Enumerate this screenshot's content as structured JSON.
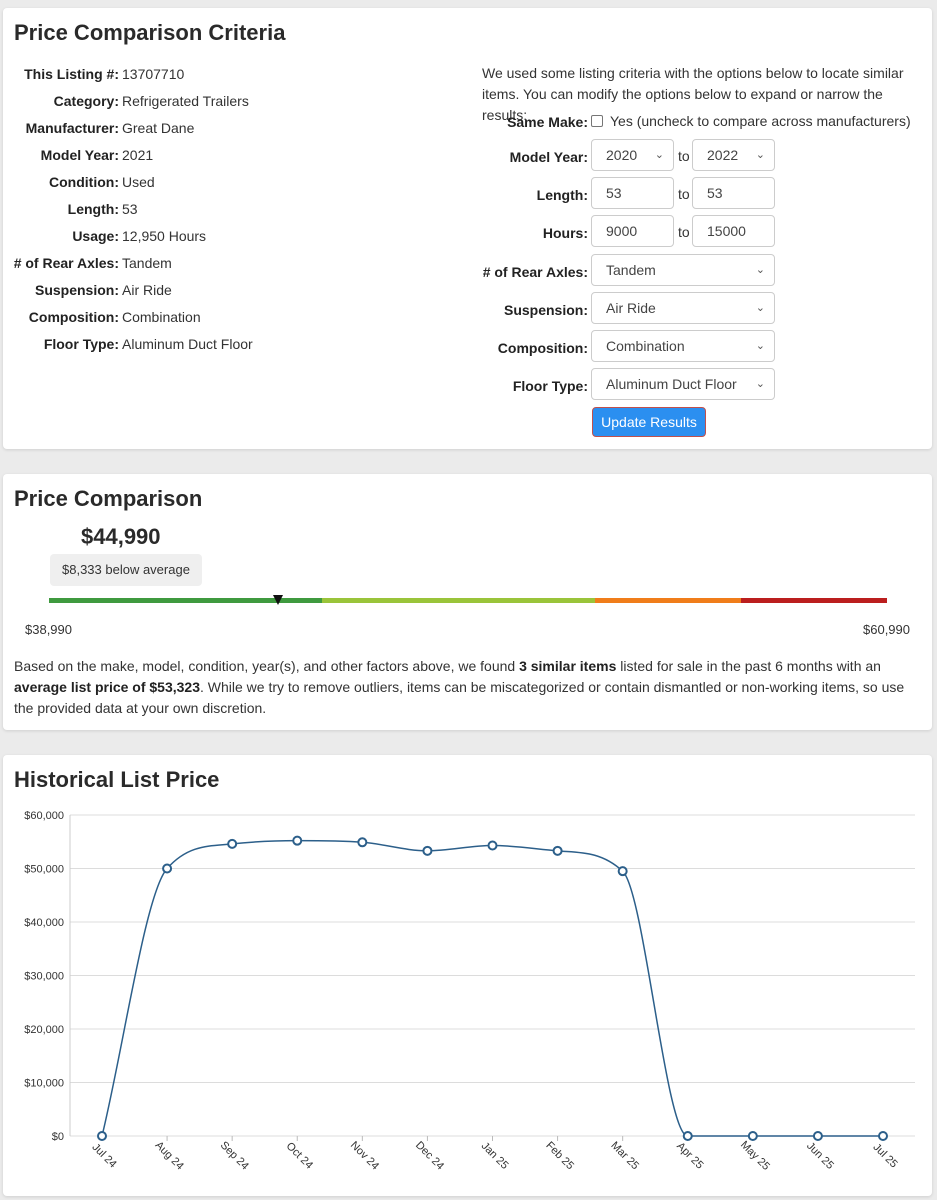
{
  "criteria": {
    "title": "Price Comparison Criteria",
    "specs": [
      {
        "label": "This Listing #:",
        "value": "13707710"
      },
      {
        "label": "Category:",
        "value": "Refrigerated Trailers"
      },
      {
        "label": "Manufacturer:",
        "value": "Great Dane"
      },
      {
        "label": "Model Year:",
        "value": "2021"
      },
      {
        "label": "Condition:",
        "value": "Used"
      },
      {
        "label": "Length:",
        "value": "53"
      },
      {
        "label": "Usage:",
        "value": "12,950 Hours"
      },
      {
        "label": "# of Rear Axles:",
        "value": "Tandem"
      },
      {
        "label": "Suspension:",
        "value": "Air Ride"
      },
      {
        "label": "Composition:",
        "value": "Combination"
      },
      {
        "label": "Floor Type:",
        "value": "Aluminum Duct Floor"
      }
    ],
    "intro": "We used some listing criteria with the options below to locate similar items. You can modify the options below to expand or narrow the results:",
    "same_make": {
      "label": "Same Make:",
      "checked": false,
      "text": "Yes (uncheck to compare across manufacturers)"
    },
    "to_text": "to",
    "model_year": {
      "label": "Model Year:",
      "from": "2020",
      "to": "2022"
    },
    "length": {
      "label": "Length:",
      "from": "53",
      "to": "53"
    },
    "hours": {
      "label": "Hours:",
      "from": "9000",
      "to": "15000"
    },
    "rear_axles": {
      "label": "# of Rear Axles:",
      "value": "Tandem"
    },
    "suspension": {
      "label": "Suspension:",
      "value": "Air Ride"
    },
    "composition": {
      "label": "Composition:",
      "value": "Combination"
    },
    "floor_type": {
      "label": "Floor Type:",
      "value": "Aluminum Duct Floor"
    },
    "update_label": "Update Results"
  },
  "comparison": {
    "title": "Price Comparison",
    "price": "$44,990",
    "below_text": "$8,333 below average",
    "range_min": "$38,990",
    "range_max": "$60,990",
    "gauge_value": 44990,
    "colors": {
      "dark_green": "#3f9a3f",
      "light_green": "#9ac43a",
      "orange": "#f07d1a",
      "red": "#bb1e1e"
    },
    "summary": {
      "part1": "Based on the make, model, condition, year(s), and other factors above, we found ",
      "bold1": "3 similar items",
      "part2": " listed for sale in the past 6 months with an ",
      "bold2": "average list price of $53,323",
      "part3": ". While we try to remove outliers, items can be miscategorized or contain dismantled or non-working items, so use the provided data at your own discretion."
    }
  },
  "history": {
    "title": "Historical List Price"
  },
  "chart_data": {
    "type": "line",
    "title": "Historical List Price",
    "xlabel": "",
    "ylabel": "",
    "x": [
      "Jul 24",
      "Aug 24",
      "Sep 24",
      "Oct 24",
      "Nov 24",
      "Dec 24",
      "Jan 25",
      "Feb 25",
      "Mar 25",
      "Apr 25",
      "May 25",
      "Jun 25",
      "Jul 25"
    ],
    "series": [
      {
        "values": [
          0,
          50000,
          54600,
          55200,
          54900,
          53300,
          54300,
          53300,
          49500,
          0,
          0,
          0,
          0
        ],
        "color": "#2c5f8a"
      }
    ],
    "ylim": [
      0,
      60000
    ],
    "yticks": [
      "$0",
      "$10,000",
      "$20,000",
      "$30,000",
      "$40,000",
      "$50,000",
      "$60,000"
    ],
    "grid": true,
    "legend": "none"
  }
}
